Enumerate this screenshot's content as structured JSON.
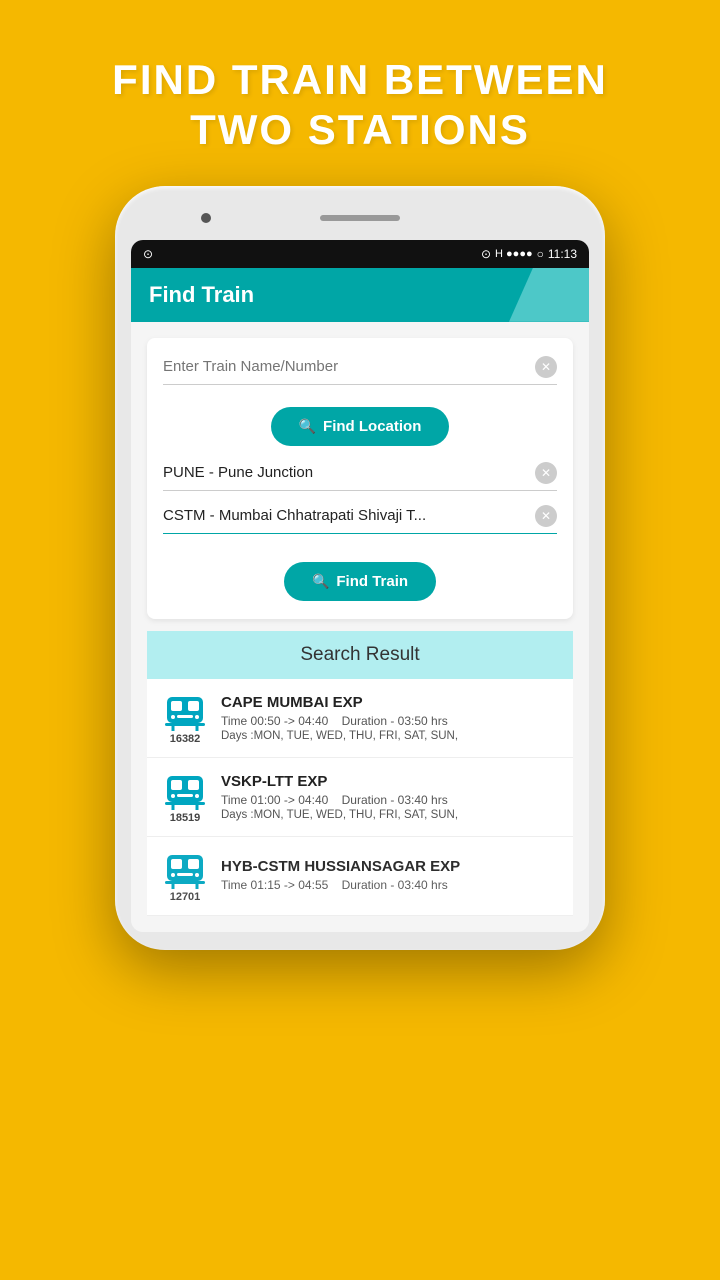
{
  "page": {
    "title": "FIND TRAIN BETWEEN TWO STATIONS"
  },
  "status_bar": {
    "left_icon": "wifi-icon",
    "signal": "H ●●●●",
    "battery": "○",
    "time": "11:13"
  },
  "app_header": {
    "title": "Find Train"
  },
  "search_card": {
    "train_input": {
      "placeholder": "Enter Train Name/Number",
      "value": ""
    },
    "find_location_button": "Find Location",
    "from_station": {
      "value": "PUNE - Pune Junction"
    },
    "to_station": {
      "value": "CSTM - Mumbai Chhatrapati Shivaji T..."
    },
    "find_train_button": "Find Train"
  },
  "search_result": {
    "header": "Search Result",
    "trains": [
      {
        "number": "16382",
        "name": "CAPE MUMBAI EXP",
        "time": "Time 00:50 -> 04:40",
        "duration": "Duration - 03:50 hrs",
        "days": "Days :MON, TUE, WED, THU, FRI, SAT, SUN,"
      },
      {
        "number": "18519",
        "name": "VSKP-LTT EXP",
        "time": "Time 01:00 -> 04:40",
        "duration": "Duration - 03:40 hrs",
        "days": "Days :MON, TUE, WED, THU, FRI, SAT, SUN,"
      },
      {
        "number": "12701",
        "name": "HYB-CSTM HUSSIANSAGAR EXP",
        "time": "Time 01:15 -> 04:55",
        "duration": "Duration - 03:40 hrs",
        "days": ""
      }
    ]
  }
}
